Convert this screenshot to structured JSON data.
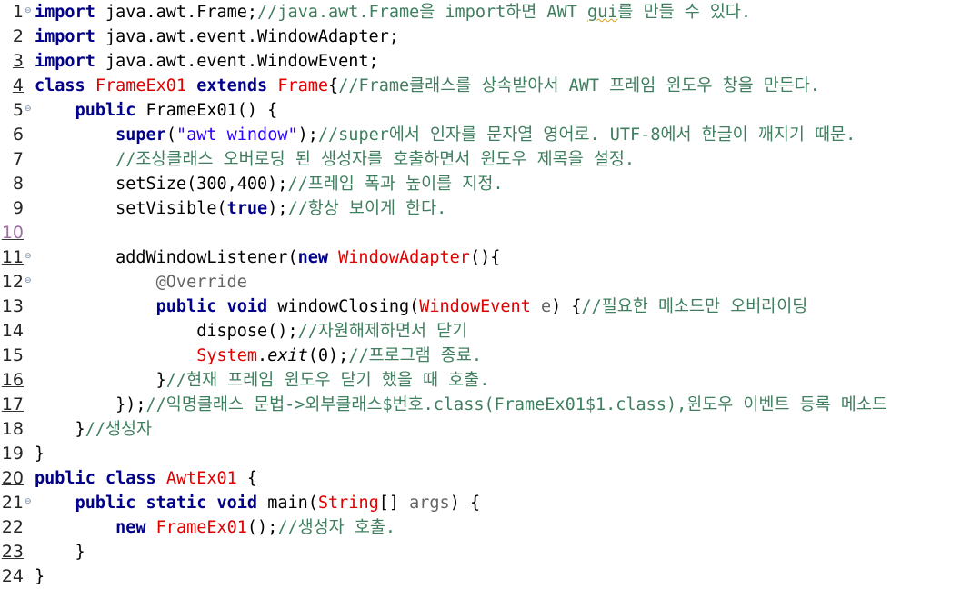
{
  "editor": {
    "lines": [
      {
        "num": "1",
        "fold": "⊖",
        "segments": [
          {
            "t": "import",
            "c": "kw"
          },
          {
            "t": " java.awt.Frame;",
            "c": ""
          },
          {
            "t": "//java.awt.Frame을 import하면 AWT ",
            "c": "cm"
          },
          {
            "t": "gui",
            "c": "cm squig"
          },
          {
            "t": "를 만들 수 있다.",
            "c": "cm"
          }
        ]
      },
      {
        "num": "2",
        "fold": "",
        "segments": [
          {
            "t": "import",
            "c": "kw"
          },
          {
            "t": " java.awt.event.WindowAdapter;",
            "c": ""
          }
        ]
      },
      {
        "num": "3",
        "fold": "",
        "segments": [
          {
            "t": "import",
            "c": "kw"
          },
          {
            "t": " java.awt.event.WindowEvent;",
            "c": ""
          }
        ]
      },
      {
        "num": "4",
        "fold": "",
        "segments": [
          {
            "t": "class",
            "c": "kw"
          },
          {
            "t": " ",
            "c": ""
          },
          {
            "t": "FrameEx01",
            "c": "cls"
          },
          {
            "t": " ",
            "c": ""
          },
          {
            "t": "extends",
            "c": "kw"
          },
          {
            "t": " ",
            "c": ""
          },
          {
            "t": "Frame",
            "c": "cls"
          },
          {
            "t": "{",
            "c": ""
          },
          {
            "t": "//Frame클래스를 상속받아서 AWT 프레임 윈도우 창을 만든다.",
            "c": "cm"
          }
        ]
      },
      {
        "num": "5",
        "fold": "⊖",
        "segments": [
          {
            "t": "    ",
            "c": ""
          },
          {
            "t": "public",
            "c": "kw"
          },
          {
            "t": " FrameEx01() {",
            "c": ""
          }
        ]
      },
      {
        "num": "6",
        "fold": "",
        "segments": [
          {
            "t": "        ",
            "c": ""
          },
          {
            "t": "super",
            "c": "kw"
          },
          {
            "t": "(",
            "c": ""
          },
          {
            "t": "\"awt window\"",
            "c": "str"
          },
          {
            "t": ");",
            "c": ""
          },
          {
            "t": "//super에서 인자를 문자열 영어로. UTF-8에서 한글이 깨지기 때문.",
            "c": "cm"
          }
        ]
      },
      {
        "num": "7",
        "fold": "",
        "segments": [
          {
            "t": "        ",
            "c": ""
          },
          {
            "t": "//조상클래스 오버로딩 된 생성자를 호출하면서 윈도우 제목을 설정.",
            "c": "cm"
          }
        ]
      },
      {
        "num": "8",
        "fold": "",
        "segments": [
          {
            "t": "        setSize(300,400);",
            "c": ""
          },
          {
            "t": "//프레임 폭과 높이를 지정.",
            "c": "cm"
          }
        ]
      },
      {
        "num": "9",
        "fold": "",
        "segments": [
          {
            "t": "        setVisible(",
            "c": ""
          },
          {
            "t": "true",
            "c": "kw"
          },
          {
            "t": ");",
            "c": ""
          },
          {
            "t": "//항상 보이게 한다.",
            "c": "cm"
          }
        ]
      },
      {
        "num": "10",
        "fold": "",
        "segments": []
      },
      {
        "num": "11",
        "fold": "⊖",
        "segments": [
          {
            "t": "        addWindowListener(",
            "c": ""
          },
          {
            "t": "new",
            "c": "kw"
          },
          {
            "t": " ",
            "c": ""
          },
          {
            "t": "WindowAdapter",
            "c": "cls"
          },
          {
            "t": "(){",
            "c": ""
          }
        ]
      },
      {
        "num": "12",
        "fold": "⊖",
        "segments": [
          {
            "t": "            ",
            "c": ""
          },
          {
            "t": "@Override",
            "c": "ann"
          }
        ]
      },
      {
        "num": "13",
        "fold": "",
        "segments": [
          {
            "t": "            ",
            "c": ""
          },
          {
            "t": "public",
            "c": "kw"
          },
          {
            "t": " ",
            "c": ""
          },
          {
            "t": "void",
            "c": "kw"
          },
          {
            "t": " windowClosing(",
            "c": ""
          },
          {
            "t": "WindowEvent",
            "c": "cls"
          },
          {
            "t": " ",
            "c": ""
          },
          {
            "t": "e",
            "c": "ann"
          },
          {
            "t": ") {",
            "c": ""
          },
          {
            "t": "//필요한 메소드만 오버라이딩",
            "c": "cm"
          }
        ]
      },
      {
        "num": "14",
        "fold": "",
        "segments": [
          {
            "t": "                dispose();",
            "c": ""
          },
          {
            "t": "//자원해제하면서 닫기",
            "c": "cm"
          }
        ]
      },
      {
        "num": "15",
        "fold": "",
        "segments": [
          {
            "t": "                ",
            "c": ""
          },
          {
            "t": "System",
            "c": "cls"
          },
          {
            "t": ".",
            "c": ""
          },
          {
            "t": "exit",
            "c": "ital"
          },
          {
            "t": "(0);",
            "c": ""
          },
          {
            "t": "//프로그램 종료.",
            "c": "cm"
          }
        ]
      },
      {
        "num": "16",
        "fold": "",
        "segments": [
          {
            "t": "            }",
            "c": ""
          },
          {
            "t": "//현재 프레임 윈도우 닫기 했을 때 호출.",
            "c": "cm"
          }
        ]
      },
      {
        "num": "17",
        "fold": "",
        "segments": [
          {
            "t": "        });",
            "c": ""
          },
          {
            "t": "//익명클래스 문법->외부클래스$번호.class(FrameEx01$1.class),윈도우 이벤트 등록 메소드",
            "c": "cm"
          }
        ]
      },
      {
        "num": "18",
        "fold": "",
        "segments": [
          {
            "t": "    }",
            "c": ""
          },
          {
            "t": "//생성자",
            "c": "cm"
          }
        ]
      },
      {
        "num": "19",
        "fold": "",
        "segments": [
          {
            "t": "}",
            "c": ""
          }
        ]
      },
      {
        "num": "20",
        "fold": "",
        "segments": [
          {
            "t": "public",
            "c": "kw"
          },
          {
            "t": " ",
            "c": ""
          },
          {
            "t": "class",
            "c": "kw"
          },
          {
            "t": " ",
            "c": ""
          },
          {
            "t": "AwtEx01",
            "c": "cls"
          },
          {
            "t": " {",
            "c": ""
          }
        ]
      },
      {
        "num": "21",
        "fold": "⊖",
        "segments": [
          {
            "t": "    ",
            "c": ""
          },
          {
            "t": "public",
            "c": "kw"
          },
          {
            "t": " ",
            "c": ""
          },
          {
            "t": "static",
            "c": "kw"
          },
          {
            "t": " ",
            "c": ""
          },
          {
            "t": "void",
            "c": "kw"
          },
          {
            "t": " main(",
            "c": ""
          },
          {
            "t": "String",
            "c": "cls"
          },
          {
            "t": "[] ",
            "c": ""
          },
          {
            "t": "args",
            "c": "ann"
          },
          {
            "t": ") {",
            "c": ""
          }
        ]
      },
      {
        "num": "22",
        "fold": "",
        "segments": [
          {
            "t": "        ",
            "c": ""
          },
          {
            "t": "new",
            "c": "kw"
          },
          {
            "t": " ",
            "c": ""
          },
          {
            "t": "FrameEx01",
            "c": "cls"
          },
          {
            "t": "();",
            "c": ""
          },
          {
            "t": "//생성자 호출.",
            "c": "cm"
          }
        ]
      },
      {
        "num": "23",
        "fold": "",
        "segments": [
          {
            "t": "    }",
            "c": ""
          }
        ]
      },
      {
        "num": "24",
        "fold": "",
        "segments": [
          {
            "t": "}",
            "c": ""
          }
        ]
      }
    ]
  }
}
